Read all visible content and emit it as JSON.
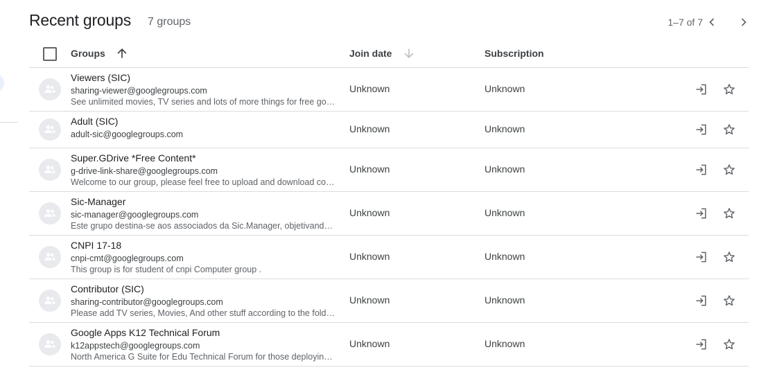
{
  "header": {
    "title": "Recent groups",
    "count": "7 groups",
    "range": "1–7 of 7",
    "prev_icon": "chevron-left-icon",
    "next_icon": "chevron-right-icon"
  },
  "columns": {
    "groups": "Groups",
    "join_date": "Join date",
    "subscription": "Subscription"
  },
  "colors": {
    "text": "#202124",
    "secondary": "#5f6368",
    "divider": "#dadce0",
    "avatar_bg": "#e8eaed"
  },
  "groups": [
    {
      "name": "Viewers (SIC)",
      "email": "sharing-viewer@googlegroups.com",
      "description": "See unlimited movies, TV series and lots of more things for free go…",
      "join_date": "Unknown",
      "subscription": "Unknown"
    },
    {
      "name": "Adult (SIC)",
      "email": "adult-sic@googlegroups.com",
      "description": "",
      "join_date": "Unknown",
      "subscription": "Unknown"
    },
    {
      "name": "Super.GDrive *Free Content*",
      "email": "g-drive-link-share@googlegroups.com",
      "description": "Welcome to our group, please feel free to upload and download co…",
      "join_date": "Unknown",
      "subscription": "Unknown"
    },
    {
      "name": "Sic-Manager",
      "email": "sic-manager@googlegroups.com",
      "description": "Este grupo destina-se aos associados da Sic.Manager, objetivand…",
      "join_date": "Unknown",
      "subscription": "Unknown"
    },
    {
      "name": "CNPI 17-18",
      "email": "cnpi-cmt@googlegroups.com",
      "description": "This group is for student of cnpi Computer group .",
      "join_date": "Unknown",
      "subscription": "Unknown"
    },
    {
      "name": "Contributor (SIC)",
      "email": "sharing-contributor@googlegroups.com",
      "description": "Please add TV series, Movies, And other stuff according to the fold…",
      "join_date": "Unknown",
      "subscription": "Unknown"
    },
    {
      "name": "Google Apps K12 Technical Forum",
      "email": "k12appstech@googlegroups.com",
      "description": "North America G Suite for Edu Technical Forum for those deployin…",
      "join_date": "Unknown",
      "subscription": "Unknown"
    }
  ]
}
